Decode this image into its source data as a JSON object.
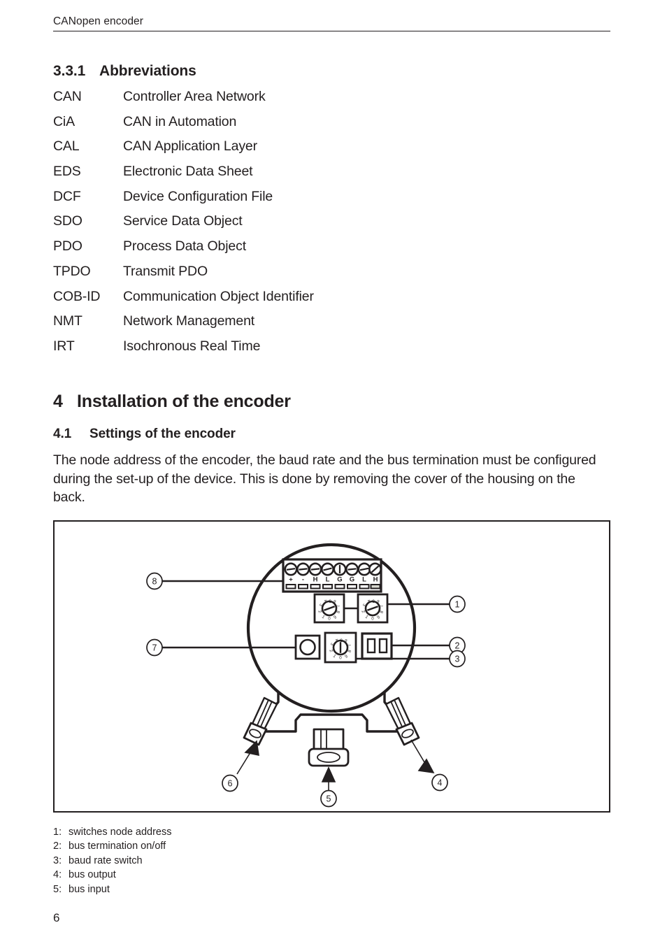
{
  "document": {
    "running_header": "CANopen encoder",
    "page_number": "6"
  },
  "abbreviations_section": {
    "number": "3.3.1",
    "title": "Abbreviations",
    "items": [
      {
        "key": "CAN",
        "value": "Controller Area Network"
      },
      {
        "key": "CiA",
        "value": "CAN in Automation"
      },
      {
        "key": "CAL",
        "value": "CAN Application Layer"
      },
      {
        "key": "EDS",
        "value": "Electronic Data Sheet"
      },
      {
        "key": "DCF",
        "value": "Device Configuration File"
      },
      {
        "key": "SDO",
        "value": "Service Data Object"
      },
      {
        "key": "PDO",
        "value": "Process Data Object"
      },
      {
        "key": "TPDO",
        "value": "Transmit PDO"
      },
      {
        "key": "COB-ID",
        "value": "Communication Object Identifier"
      },
      {
        "key": "NMT",
        "value": "Network Management"
      },
      {
        "key": "IRT",
        "value": "Isochronous Real Time"
      }
    ]
  },
  "installation_section": {
    "number": "4",
    "title": "Installation of the encoder",
    "subsection": {
      "number": "4.1",
      "title": "Settings of the encoder",
      "paragraph": "The node address of the encoder, the baud rate and the bus termination must be configured during the set-up of the device. This is done by removing the cover of the housing on the back."
    }
  },
  "figure": {
    "terminal_labels": [
      "+",
      "-",
      "H",
      "L",
      "G",
      "G",
      "L",
      "H"
    ],
    "rotary_digits": [
      "0",
      "1",
      "2",
      "3",
      "4",
      "5",
      "6",
      "7",
      "8",
      "9"
    ],
    "callouts": [
      {
        "id": "1",
        "label": "1"
      },
      {
        "id": "2",
        "label": "2"
      },
      {
        "id": "3",
        "label": "3"
      },
      {
        "id": "4",
        "label": "4"
      },
      {
        "id": "5",
        "label": "5"
      },
      {
        "id": "6",
        "label": "6"
      },
      {
        "id": "7",
        "label": "7"
      },
      {
        "id": "8",
        "label": "8"
      }
    ]
  },
  "legend": {
    "items": [
      {
        "key": "1:",
        "value": "switches node address"
      },
      {
        "key": "2:",
        "value": "bus termination on/off"
      },
      {
        "key": "3:",
        "value": "baud rate switch"
      },
      {
        "key": "4:",
        "value": "bus output"
      },
      {
        "key": "5:",
        "value": "bus input"
      }
    ]
  },
  "colors": {
    "ink": "#231f20",
    "paper": "#ffffff"
  }
}
